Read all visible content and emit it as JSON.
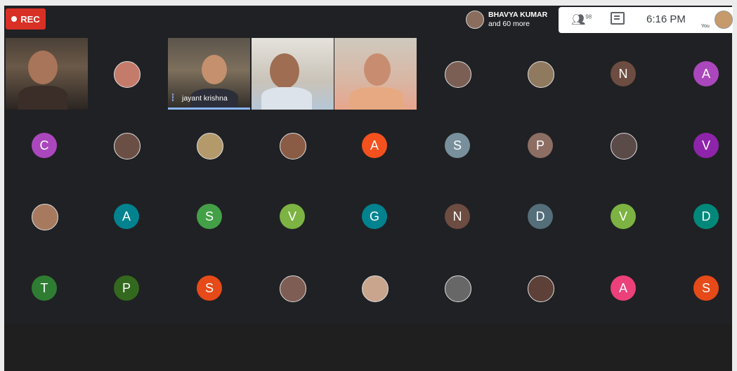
{
  "rec_label": "REC",
  "presenter": {
    "name": "BHAVYA KUMAR",
    "others": "and 60 more"
  },
  "toolbar": {
    "people_count": "98",
    "time": "6:16 PM",
    "you_label": "You"
  },
  "videos": [
    {
      "label": ""
    },
    {
      "label": "jayant krishna",
      "speaking": true
    },
    {
      "label": ""
    },
    {
      "label": ""
    }
  ],
  "tiles": [
    {
      "kind": "photo",
      "color": "#c47b6a"
    },
    {
      "kind": "photo",
      "color": "#7b5f55"
    },
    {
      "kind": "photo",
      "color": "#8f7a5f"
    },
    {
      "kind": "letter",
      "letter": "N",
      "color": "#6d4c41"
    },
    {
      "kind": "letter",
      "letter": "A",
      "color": "#ab47bc"
    },
    {
      "kind": "letter",
      "letter": "C",
      "color": "#ab47bc"
    },
    {
      "kind": "photo",
      "color": "#6b4f45"
    },
    {
      "kind": "photo",
      "color": "#b49a6b"
    },
    {
      "kind": "photo",
      "color": "#8a5c45"
    },
    {
      "kind": "letter",
      "letter": "A",
      "color": "#f4511e"
    },
    {
      "kind": "letter",
      "letter": "S",
      "color": "#78909c"
    },
    {
      "kind": "letter",
      "letter": "P",
      "color": "#8d6e63"
    },
    {
      "kind": "photo",
      "color": "#5a4a48"
    },
    {
      "kind": "letter",
      "letter": "V",
      "color": "#8e24aa"
    },
    {
      "kind": "photo",
      "color": "#a77a5f"
    },
    {
      "kind": "letter",
      "letter": "A",
      "color": "#00838f"
    },
    {
      "kind": "letter",
      "letter": "S",
      "color": "#43a047"
    },
    {
      "kind": "letter",
      "letter": "V",
      "color": "#7cb342"
    },
    {
      "kind": "letter",
      "letter": "G",
      "color": "#00838f"
    },
    {
      "kind": "letter",
      "letter": "N",
      "color": "#6d4c41"
    },
    {
      "kind": "letter",
      "letter": "D",
      "color": "#546e7a"
    },
    {
      "kind": "letter",
      "letter": "V",
      "color": "#7cb342"
    },
    {
      "kind": "letter",
      "letter": "D",
      "color": "#00897b"
    },
    {
      "kind": "letter",
      "letter": "T",
      "color": "#2e7d32"
    },
    {
      "kind": "letter",
      "letter": "P",
      "color": "#33691e"
    },
    {
      "kind": "letter",
      "letter": "S",
      "color": "#e64a19"
    },
    {
      "kind": "photo",
      "color": "#7e5d54"
    },
    {
      "kind": "photo",
      "color": "#c9a58d"
    },
    {
      "kind": "photo",
      "color": "#676767"
    },
    {
      "kind": "photo",
      "color": "#5d4037"
    },
    {
      "kind": "letter",
      "letter": "A",
      "color": "#ec407a"
    },
    {
      "kind": "letter",
      "letter": "S",
      "color": "#e64a19"
    }
  ]
}
